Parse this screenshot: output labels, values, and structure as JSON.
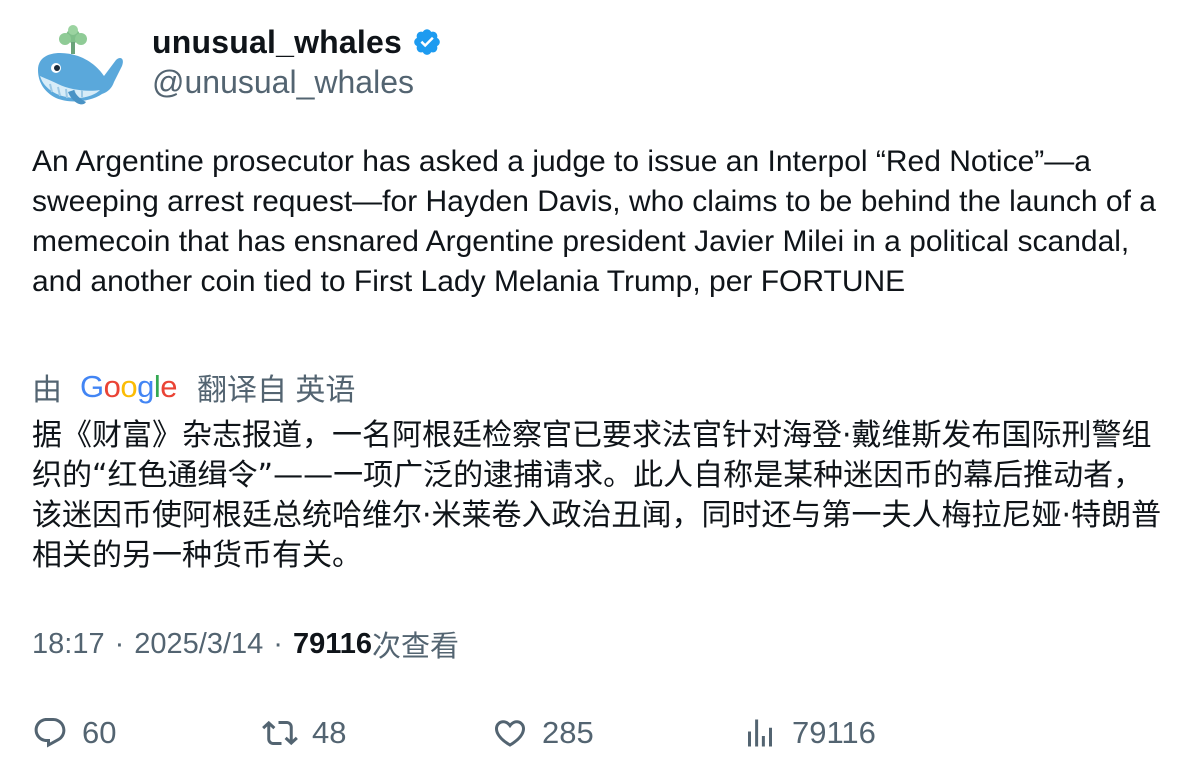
{
  "author": {
    "display_name": "unusual_whales",
    "handle": "@unusual_whales",
    "verified": true,
    "avatar_icon": "whale-avatar-icon",
    "verified_color": "#1d9bf0"
  },
  "tweet": {
    "text": "An Argentine prosecutor has asked a judge to issue an Interpol “Red Notice”—a sweeping arrest request—for Hayden Davis, who claims to be behind the launch of a memecoin that has ensnared Argentine president Javier Milei in a political scandal, and another coin tied to First Lady Melania Trump, per FORTUNE"
  },
  "translation": {
    "prefix": "由",
    "provider": "Google",
    "suffix": "翻译自 英语",
    "text": "据《财富》杂志报道，一名阿根廷检察官已要求法官针对海登·戴维斯发布国际刑警组织的“红色通缉令”——一项广泛的逮捕请求。此人自称是某种迷因币的幕后推动者，该迷因币使阿根廷总统哈维尔·米莱卷入政治丑闻，同时还与第一夫人梅拉尼娅·特朗普相关的另一种货币有关。"
  },
  "meta": {
    "time": "18:17",
    "separator": "·",
    "date": "2025/3/14",
    "views_count": "79116",
    "views_label": "次查看"
  },
  "actions": {
    "reply": {
      "icon": "reply-icon",
      "count": "60"
    },
    "retweet": {
      "icon": "retweet-icon",
      "count": "48"
    },
    "like": {
      "icon": "heart-icon",
      "count": "285"
    },
    "views": {
      "icon": "analytics-icon",
      "count": "79116"
    }
  },
  "colors": {
    "text_primary": "#0f1419",
    "text_secondary": "#536471",
    "google_blue": "#4285F4",
    "google_red": "#EA4335",
    "google_yellow": "#FBBC05",
    "google_green": "#34A853"
  }
}
